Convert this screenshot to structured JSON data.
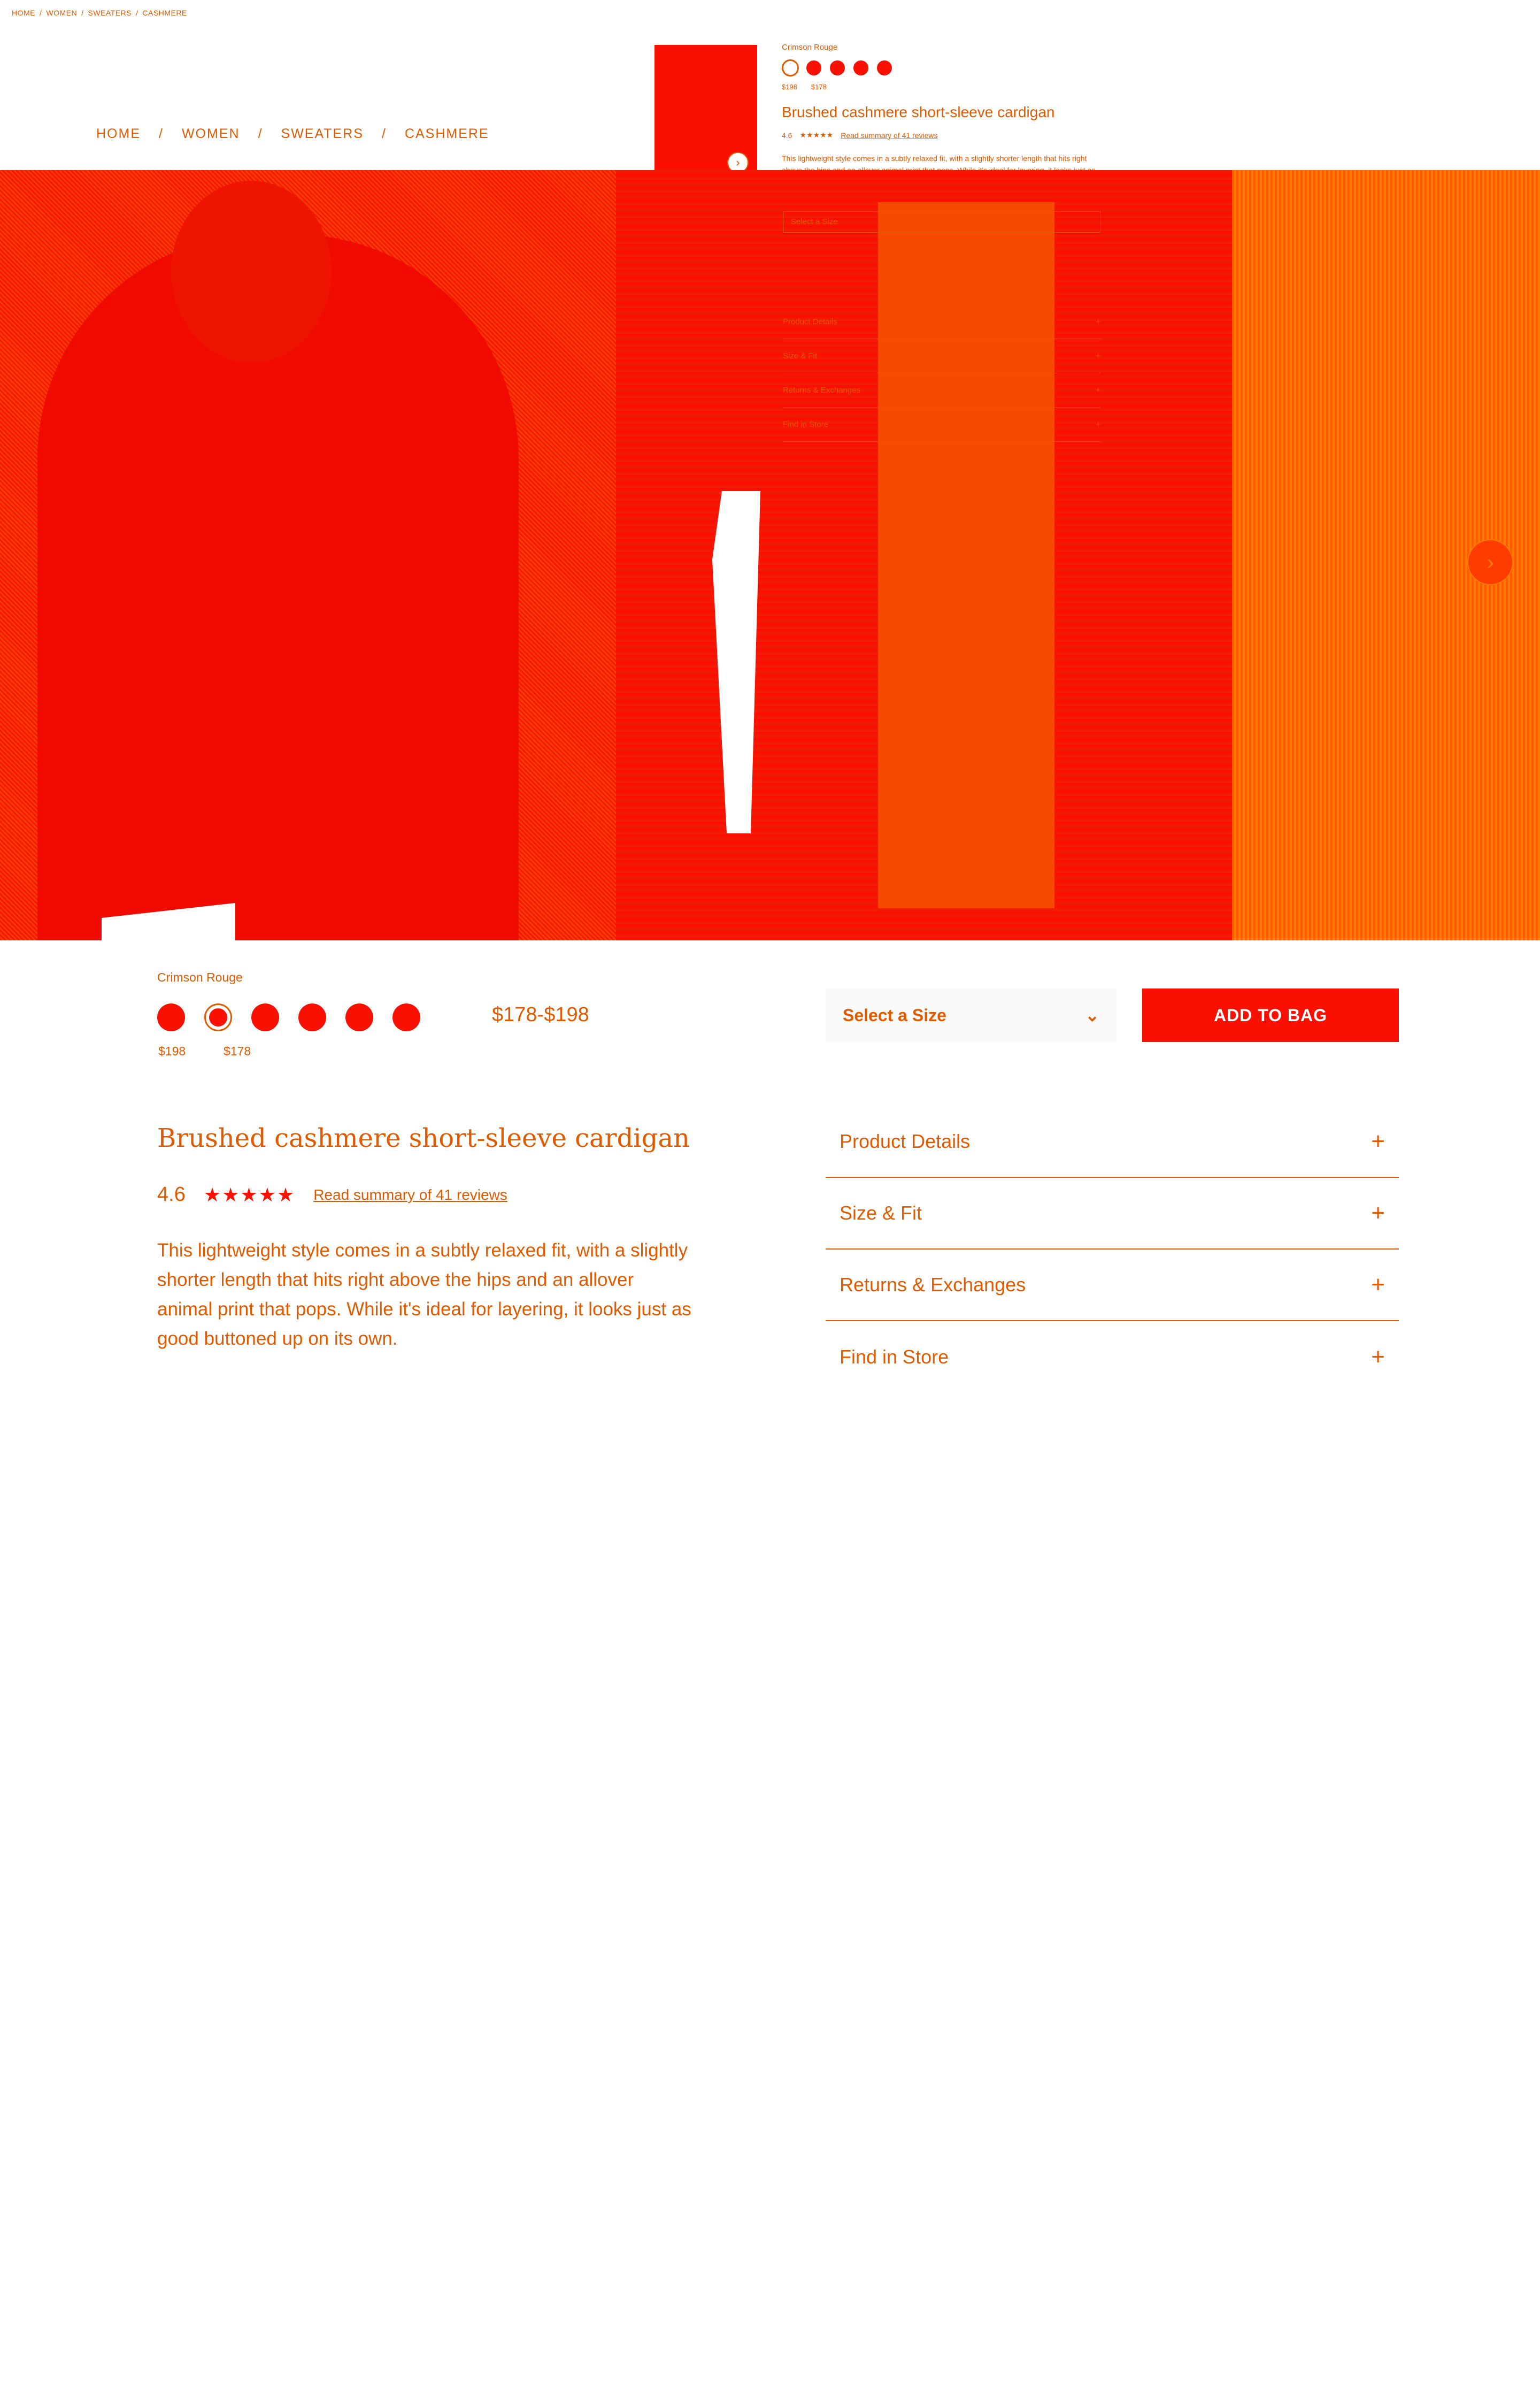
{
  "mini_breadcrumb": [
    "HOME",
    "WOMEN",
    "SWEATERS",
    "CASHMERE"
  ],
  "breadcrumb": [
    "HOME",
    "WOMEN",
    "SWEATERS",
    "CASHMERE"
  ],
  "overlay": {
    "color_name": "Crimson Rouge",
    "prices": [
      "$198",
      "$178"
    ],
    "title": "Brushed cashmere short-sleeve cardigan",
    "rating": "4.6",
    "stars": "★★★★★",
    "reviews_link": "Read summary of 41 reviews",
    "description": "This lightweight style comes in a subtly relaxed fit, with a slightly shorter length that hits right above the hips and an allover animal print that pops. While it's ideal for layering, it looks just as good buttoned up on its own.",
    "select_size": "Select a Size",
    "accordion": [
      "Product Details",
      "Size & Fit",
      "Returns & Exchanges",
      "Find in Store"
    ]
  },
  "product": {
    "color_label": "Crimson Rouge",
    "swatch_prices": [
      "$198",
      "$178"
    ],
    "price_range": "$178-$198",
    "size_select": "Select a Size",
    "add_to_bag": "ADD TO BAG",
    "title": "Brushed cashmere short-sleeve cardigan",
    "rating": "4.6",
    "stars": "★★★★★",
    "reviews_link": "Read summary of 41 reviews",
    "description": "This lightweight style comes in a subtly relaxed fit, with a slightly shorter length that hits right above the hips and an allover animal print that pops. While it's ideal for layering, it looks just as good buttoned up on its own."
  },
  "accordion": [
    {
      "label": "Product Details",
      "icon": "plus-icon"
    },
    {
      "label": "Size & Fit",
      "icon": "plus-icon"
    },
    {
      "label": "Returns & Exchanges",
      "icon": "plus-icon"
    },
    {
      "label": "Find in Store",
      "icon": "plus-icon"
    }
  ],
  "icons": {
    "chevron_right": "›",
    "chevron_down": "⌄",
    "plus": "+"
  },
  "colors": {
    "accent": "#fb0f00",
    "text": "#e05a00",
    "background": "#ffffff"
  }
}
